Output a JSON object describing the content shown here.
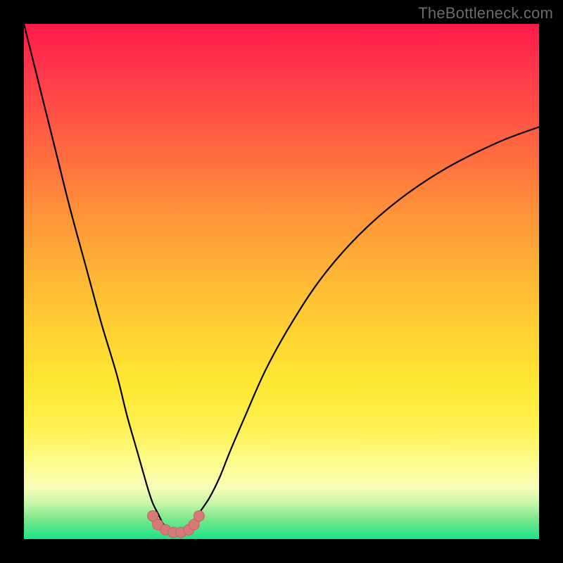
{
  "brand": "TheBottleneck.com",
  "chart_data": {
    "type": "line",
    "title": "",
    "xlabel": "",
    "ylabel": "",
    "xlim": [
      0,
      100
    ],
    "ylim": [
      0,
      100
    ],
    "series": [
      {
        "name": "left-branch",
        "x": [
          0,
          3,
          6,
          9,
          12,
          15,
          18,
          20,
          22,
          24,
          25,
          26,
          27,
          28
        ],
        "values": [
          100,
          88,
          76,
          64,
          53,
          42,
          32,
          24,
          17,
          10,
          7,
          5,
          3,
          2
        ]
      },
      {
        "name": "right-branch",
        "x": [
          32,
          33,
          34,
          36,
          38,
          40,
          43,
          47,
          52,
          58,
          65,
          73,
          82,
          92,
          100
        ],
        "values": [
          2,
          3,
          5,
          8,
          12,
          17,
          24,
          33,
          42,
          51,
          59,
          66,
          72,
          77,
          80
        ]
      },
      {
        "name": "valley-markers",
        "x": [
          25,
          26,
          27.5,
          29,
          30.5,
          32,
          33,
          34
        ],
        "values": [
          4.5,
          2.8,
          1.8,
          1.3,
          1.3,
          1.8,
          2.8,
          4.5
        ]
      }
    ],
    "colors": {
      "curve": "#000000",
      "marker_fill": "#d47a78",
      "marker_stroke": "#c76260"
    }
  }
}
